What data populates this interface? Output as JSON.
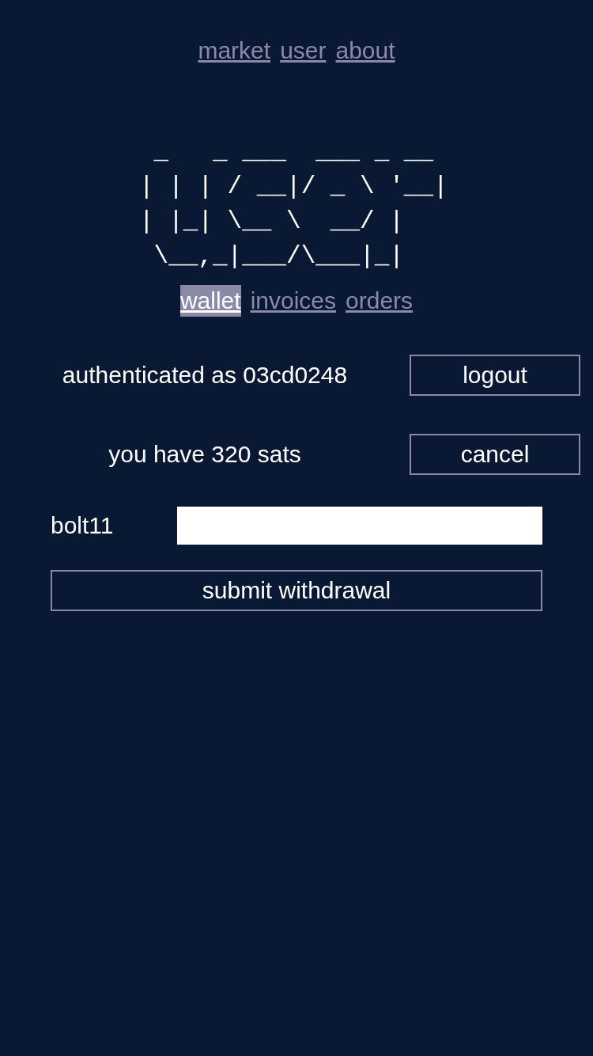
{
  "nav": [
    {
      "label": "market"
    },
    {
      "label": "user"
    },
    {
      "label": "about"
    }
  ],
  "logo": " _   _ ___  ___ _ __\n| | | / __|/ _ \\ '__|\n| |_| \\__ \\  __/ |\n \\__,_|___/\\___|_|",
  "tabs": [
    {
      "label": "wallet",
      "selected": true
    },
    {
      "label": "invoices",
      "selected": false
    },
    {
      "label": "orders",
      "selected": false
    }
  ],
  "rows": [
    {
      "text": "authenticated as 03cd0248",
      "button": "logout"
    },
    {
      "text": "you have 320 sats",
      "button": "cancel"
    }
  ],
  "field": {
    "label": "bolt11"
  },
  "submit": "submit withdrawal"
}
